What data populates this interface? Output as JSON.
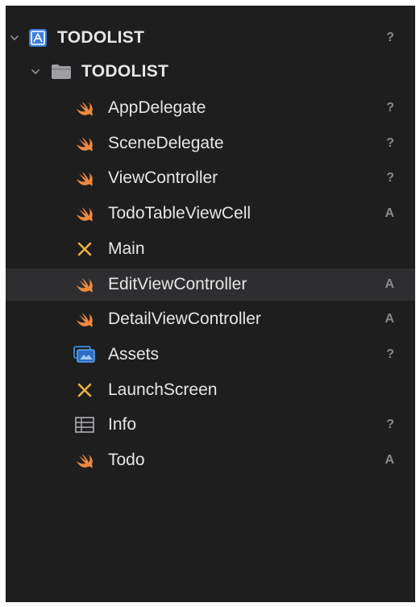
{
  "project": {
    "name": "TODOLIST",
    "status": "?"
  },
  "group": {
    "name": "TODOLIST"
  },
  "files": [
    {
      "name": "AppDelegate",
      "icon": "swift-icon",
      "status": "?"
    },
    {
      "name": "SceneDelegate",
      "icon": "swift-icon",
      "status": "?"
    },
    {
      "name": "ViewController",
      "icon": "swift-icon",
      "status": "?"
    },
    {
      "name": "TodoTableViewCell",
      "icon": "swift-icon",
      "status": "A"
    },
    {
      "name": "Main",
      "icon": "storyboard-icon",
      "status": ""
    },
    {
      "name": "EditViewController",
      "icon": "swift-icon",
      "status": "A",
      "selected": true
    },
    {
      "name": "DetailViewController",
      "icon": "swift-icon",
      "status": "A"
    },
    {
      "name": "Assets",
      "icon": "assets-icon",
      "status": "?"
    },
    {
      "name": "LaunchScreen",
      "icon": "storyboard-icon",
      "status": ""
    },
    {
      "name": "Info",
      "icon": "plist-icon",
      "status": "?"
    },
    {
      "name": "Todo",
      "icon": "swift-icon",
      "status": "A"
    }
  ],
  "colors": {
    "background": "#1e1e1f",
    "selection": "#2e2e31",
    "swift": "#f0883e",
    "project": "#3d7fe0",
    "text": "#e6e6e6",
    "status": "#8a8a8c"
  }
}
